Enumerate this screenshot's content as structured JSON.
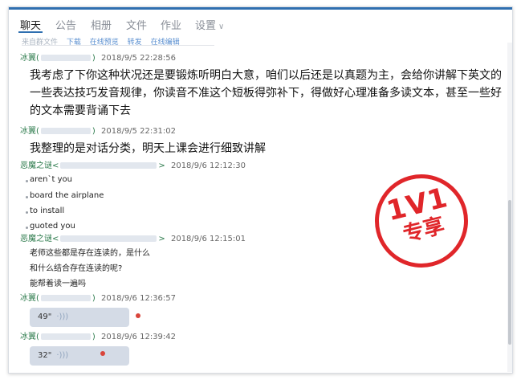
{
  "tabs": [
    {
      "label": "聊天"
    },
    {
      "label": "公告"
    },
    {
      "label": "相册"
    },
    {
      "label": "文件"
    },
    {
      "label": "作业"
    },
    {
      "label": "设置"
    }
  ],
  "accent": "#2f6fb0",
  "strip_text": {
    "a": "来自群文件",
    "b": "下载",
    "c": "在线预览",
    "d": "转发",
    "e": "在线编辑"
  },
  "messages": [
    {
      "sender": "冰翼(",
      "sender_tail": ")",
      "time": "2018/9/5 22:28:56",
      "lines": [
        "我考虑了下你这种状况还是要锻炼听明白大意，咱们以后还是以真题为主，会给你讲解下英文的",
        "一些表达技巧发音规律，你读音不准这个短板得弥补下，得做好心理准备多读文本，甚至一些好",
        "的文本需要背诵下去"
      ]
    },
    {
      "sender": "冰翼(",
      "sender_tail": ")",
      "time": "2018/9/5 22:31:02",
      "lines": [
        "我整理的是对话分类，明天上课会进行细致讲解"
      ]
    },
    {
      "sender": "恶魔之谜<",
      "sender_tail": ">",
      "time": "2018/9/6 12:12:30",
      "items": [
        "aren`t  you",
        "board the airplane",
        "to install",
        "guoted you"
      ]
    },
    {
      "sender": "恶魔之谜<",
      "sender_tail": ">",
      "time": "2018/9/6 12:15:01",
      "lines": [
        "老师这些都是存在连读的，是什么",
        "和什么结合存在连读的呢?",
        "能帮着读一遍吗"
      ]
    },
    {
      "sender": "冰翼(",
      "sender_tail": ")",
      "time": "2018/9/6 12:36:57",
      "voice": "49\""
    },
    {
      "sender": "冰翼(",
      "sender_tail": ")",
      "time": "2018/9/6 12:39:42",
      "voice": "32\""
    }
  ],
  "stamp": {
    "line1": "1V1",
    "line2": "专享",
    "color": "#e0262a"
  }
}
